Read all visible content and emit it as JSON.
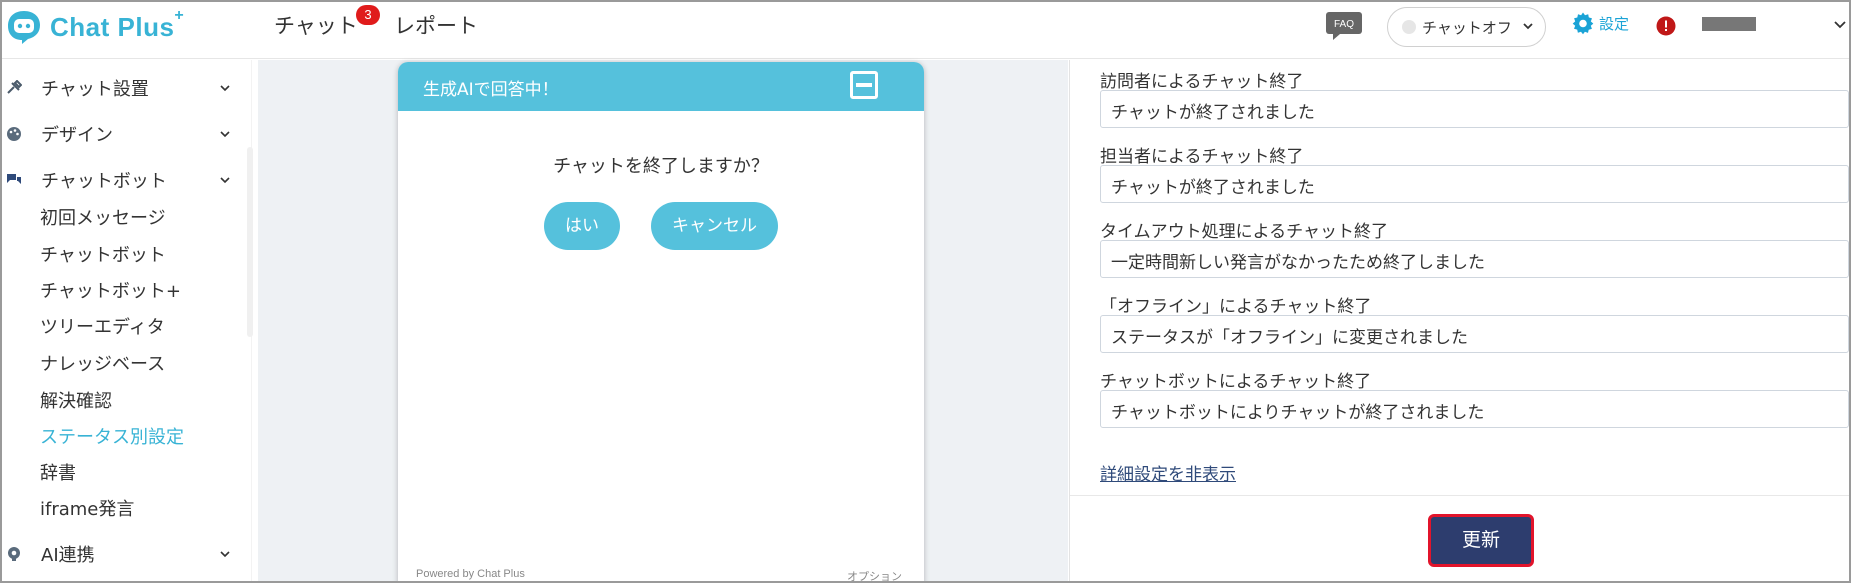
{
  "app": {
    "logo_text": "Chat Plus",
    "logo_sup": "+"
  },
  "header": {
    "nav": [
      {
        "label": "チャット",
        "badge": "3"
      },
      {
        "label": "レポート"
      }
    ],
    "faq_label": "FAQ",
    "status_select": {
      "value": "チャットオフ"
    },
    "settings_label": "設定"
  },
  "sidebar": {
    "sections": [
      {
        "label": "チャット設置",
        "icon": "tools-icon"
      },
      {
        "label": "デザイン",
        "icon": "palette-icon"
      },
      {
        "label": "チャットボット",
        "icon": "chat-bubbles-icon"
      }
    ],
    "items": [
      {
        "label": "初回メッセージ"
      },
      {
        "label": "チャットボット"
      },
      {
        "label": "チャットボット+"
      },
      {
        "label": "ツリーエディタ"
      },
      {
        "label": "ナレッジベース"
      },
      {
        "label": "解決確認"
      },
      {
        "label": "ステータス別設定",
        "active": true
      },
      {
        "label": "辞書"
      },
      {
        "label": "iframe発言"
      }
    ],
    "bottom_section": {
      "label": "AI連携",
      "icon": "brain-icon"
    }
  },
  "widget": {
    "title": "生成AIで回答中！",
    "confirm_text": "チャットを終了しますか？",
    "yes_label": "はい",
    "cancel_label": "キャンセル",
    "footer_left": "Powered by Chat Plus",
    "footer_right": "オプション"
  },
  "panel": {
    "fields": [
      {
        "label": "訪問者によるチャット終了",
        "value": "チャットが終了されました"
      },
      {
        "label": "担当者によるチャット終了",
        "value": "チャットが終了されました"
      },
      {
        "label": "タイムアウト処理によるチャット終了",
        "value": "一定時間新しい発言がなかったため終了しました"
      },
      {
        "label": "「オフライン」によるチャット終了",
        "value": "ステータスが「オフライン」に変更されました"
      },
      {
        "label": "チャットボットによるチャット終了",
        "value": "チャットボットによりチャットが終了されました"
      }
    ],
    "detail_link": "詳細設定を非表示",
    "update_label": "更新"
  },
  "colors": {
    "accent": "#55c1dc",
    "brand": "#38b3d5",
    "update_button": "#2d3d6e",
    "highlight_border": "#e2142b",
    "badge": "#e01b1b"
  }
}
